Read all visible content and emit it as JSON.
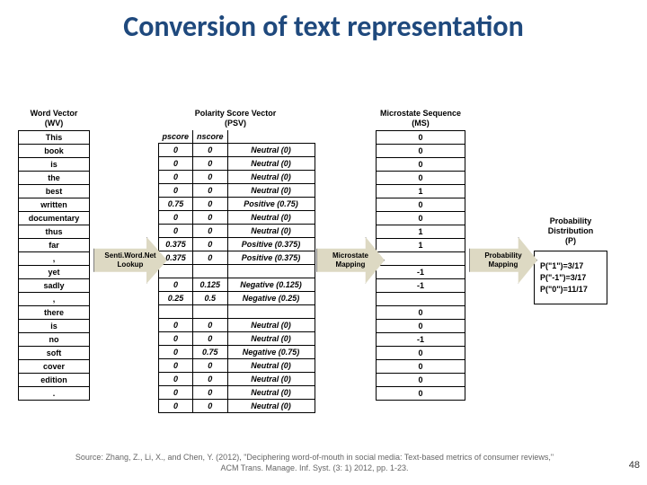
{
  "title": "Conversion of text representation",
  "wv": {
    "header1": "Word Vector",
    "header2": "(WV)",
    "rows": [
      "This",
      "book",
      "is",
      "the",
      "best",
      "written",
      "documentary",
      "thus",
      "far",
      ",",
      "yet",
      "sadly",
      ",",
      "there",
      "is",
      "no",
      "soft",
      "cover",
      "edition",
      "."
    ]
  },
  "arrow1": "Senti.Word.Net Lookup",
  "psv": {
    "header1": "Polarity Score Vector",
    "header2": "(PSV)",
    "subhdr_left": "pscore",
    "subhdr_right": "nscore",
    "rows": [
      {
        "p": "0",
        "n": "0",
        "lbl": "Neutral (0)"
      },
      {
        "p": "0",
        "n": "0",
        "lbl": "Neutral (0)"
      },
      {
        "p": "0",
        "n": "0",
        "lbl": "Neutral (0)"
      },
      {
        "p": "0",
        "n": "0",
        "lbl": "Neutral (0)"
      },
      {
        "p": "0.75",
        "n": "0",
        "lbl": "Positive (0.75)"
      },
      {
        "p": "0",
        "n": "0",
        "lbl": "Neutral (0)"
      },
      {
        "p": "0",
        "n": "0",
        "lbl": "Neutral (0)"
      },
      {
        "p": "0.375",
        "n": "0",
        "lbl": "Positive (0.375)"
      },
      {
        "p": "0.375",
        "n": "0",
        "lbl": "Positive (0.375)"
      },
      {
        "p": "",
        "n": "",
        "lbl": ""
      },
      {
        "p": "0",
        "n": "0.125",
        "lbl": "Negative (0.125)"
      },
      {
        "p": "0.25",
        "n": "0.5",
        "lbl": "Negative (0.25)"
      },
      {
        "p": "",
        "n": "",
        "lbl": ""
      },
      {
        "p": "0",
        "n": "0",
        "lbl": "Neutral (0)"
      },
      {
        "p": "0",
        "n": "0",
        "lbl": "Neutral (0)"
      },
      {
        "p": "0",
        "n": "0.75",
        "lbl": "Negative (0.75)"
      },
      {
        "p": "0",
        "n": "0",
        "lbl": "Neutral (0)"
      },
      {
        "p": "0",
        "n": "0",
        "lbl": "Neutral (0)"
      },
      {
        "p": "0",
        "n": "0",
        "lbl": "Neutral (0)"
      },
      {
        "p": "0",
        "n": "0",
        "lbl": "Neutral (0)"
      }
    ]
  },
  "arrow2": "Microstate Mapping",
  "ms": {
    "header1": "Microstate Sequence",
    "header2": "(MS)",
    "rows": [
      "0",
      "0",
      "0",
      "0",
      "1",
      "0",
      "0",
      "1",
      "1",
      "",
      "-1",
      "-1",
      "",
      "0",
      "0",
      "-1",
      "0",
      "0",
      "0",
      "0"
    ]
  },
  "arrow3": "Probability Mapping",
  "prob": {
    "header1": "Probability",
    "header2": "Distribution",
    "header3": "(P)",
    "lines": [
      "P(\"1\")=3/17",
      "P(\"-1\")=3/17",
      "P(\"0\")=11/17"
    ]
  },
  "source_line1": "Source: Zhang, Z., Li, X., and Chen, Y. (2012), \"Deciphering word-of-mouth in social media: Text-based metrics of consumer reviews,\"",
  "source_line2": "ACM Trans. Manage. Inf. Syst. (3: 1) 2012, pp. 1-23.",
  "pagenum": "48"
}
